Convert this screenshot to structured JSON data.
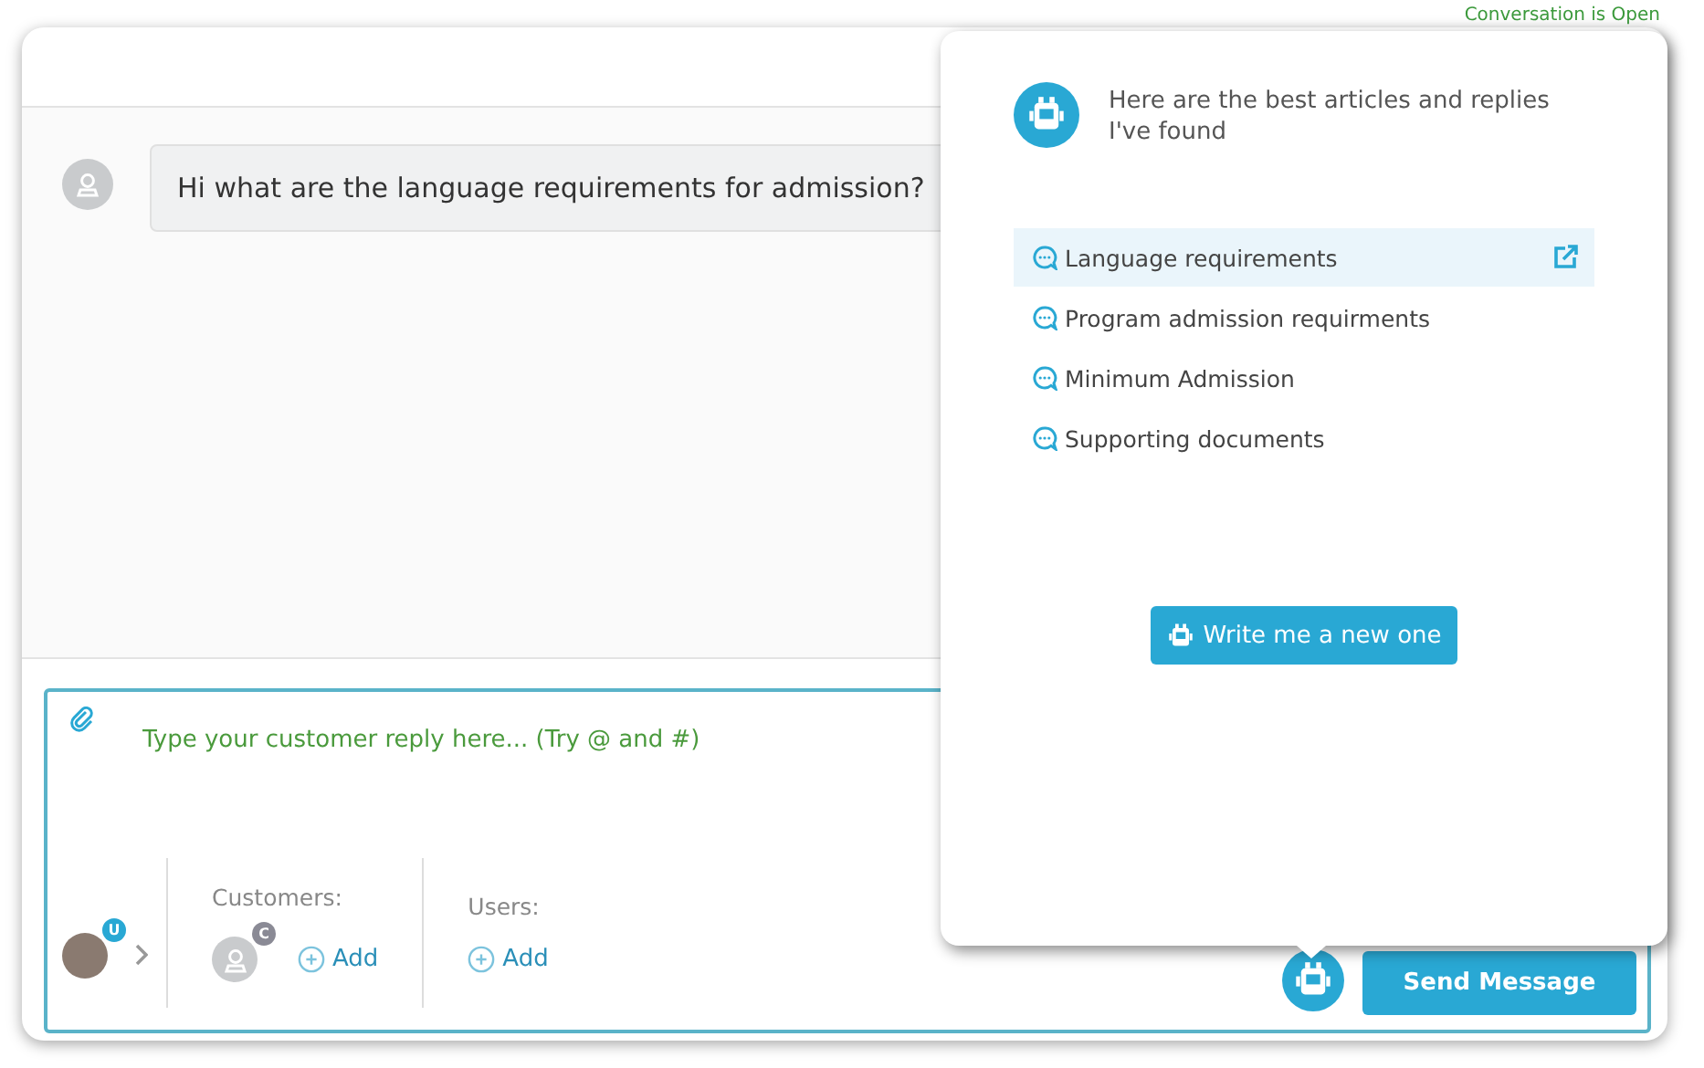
{
  "status": "Conversation is Open",
  "messages": [
    {
      "text": "Hi what are the language requirements for admission?"
    }
  ],
  "composer": {
    "placeholder": "Type your customer reply here... (Try @ and #)",
    "agent_badge": "U",
    "customers": {
      "label": "Customers:",
      "badge": "C",
      "add": "Add"
    },
    "users": {
      "label": "Users:",
      "add": "Add"
    },
    "send": "Send Message"
  },
  "suggestions": {
    "intro": "Here are the best articles and replies I've found",
    "articles": [
      {
        "title": "Language requirements",
        "selected": true
      },
      {
        "title": "Program admission requirments",
        "selected": false
      },
      {
        "title": "Minimum Admission",
        "selected": false
      },
      {
        "title": "Supporting documents",
        "selected": false
      }
    ],
    "write_button": "Write me a new one"
  }
}
